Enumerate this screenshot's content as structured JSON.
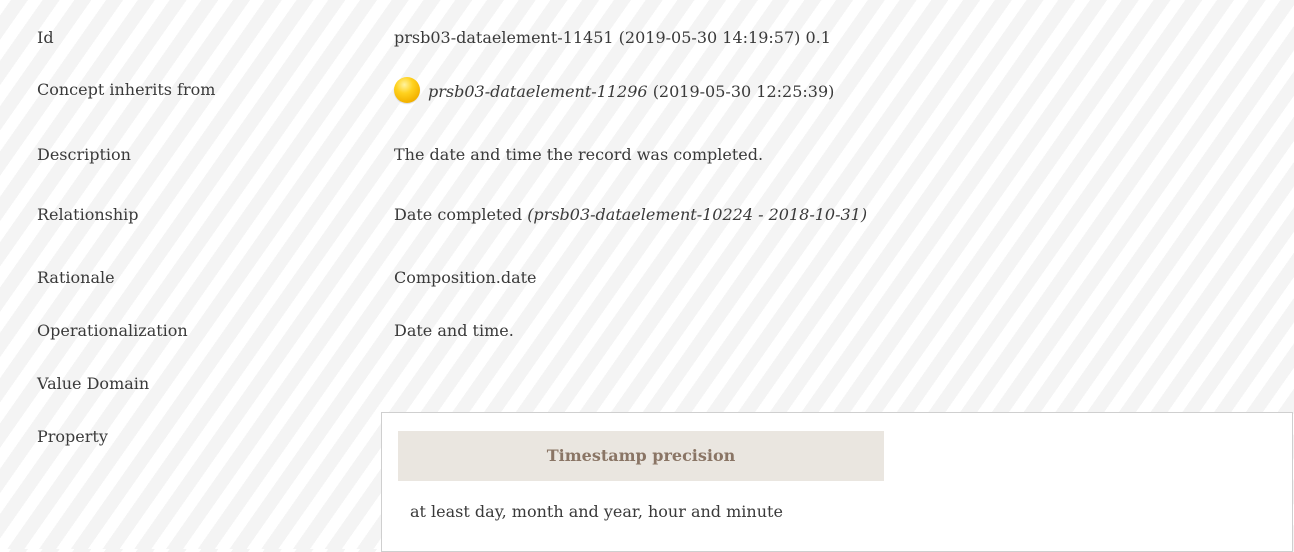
{
  "rows": {
    "id": {
      "label": "Id",
      "value": "prsb03-dataelement-11451 (2019-05-30 14:19:57) 0.1"
    },
    "inherits": {
      "label": "Concept inherits from",
      "link": "prsb03-dataelement-11296",
      "date": "(2019-05-30 12:25:39)",
      "status_icon": "status-draft-icon",
      "status_color": "#f4b400"
    },
    "description": {
      "label": "Description",
      "value": "The date and time the record was completed."
    },
    "relationship": {
      "label": "Relationship",
      "value": "Date completed",
      "ref": "(prsb03-dataelement-10224 - 2018-10-31)"
    },
    "rationale": {
      "label": "Rationale",
      "value": "Composition.date"
    },
    "operationalization": {
      "label": "Operationalization",
      "value": "Date and time."
    },
    "value_domain": {
      "label": "Value Domain"
    },
    "property": {
      "label": "Property"
    }
  },
  "property_panel": {
    "header": "Timestamp precision",
    "value": "at least day, month and year, hour and minute"
  }
}
